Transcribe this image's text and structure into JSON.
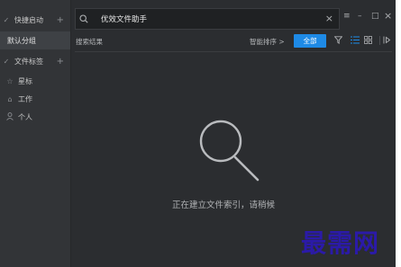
{
  "sidebar": {
    "section_quick": "快捷启动",
    "default_group": "默认分组",
    "section_tags": "文件标签",
    "tags": [
      {
        "label": "星标",
        "icon": "star-icon"
      },
      {
        "label": "工作",
        "icon": "home-icon"
      },
      {
        "label": "个人",
        "icon": "person-icon"
      }
    ]
  },
  "search": {
    "value": "优效文件助手"
  },
  "window": {
    "menu_icon": "≡",
    "minimize_icon": "–",
    "maximize_icon": "□",
    "close_icon": "×"
  },
  "toolbar": {
    "results_label": "搜索结果",
    "sort_label": "智能排序 >",
    "all_button": "全部"
  },
  "empty_state": {
    "message": "正在建立文件索引，请稍候"
  },
  "watermark": "最需网"
}
